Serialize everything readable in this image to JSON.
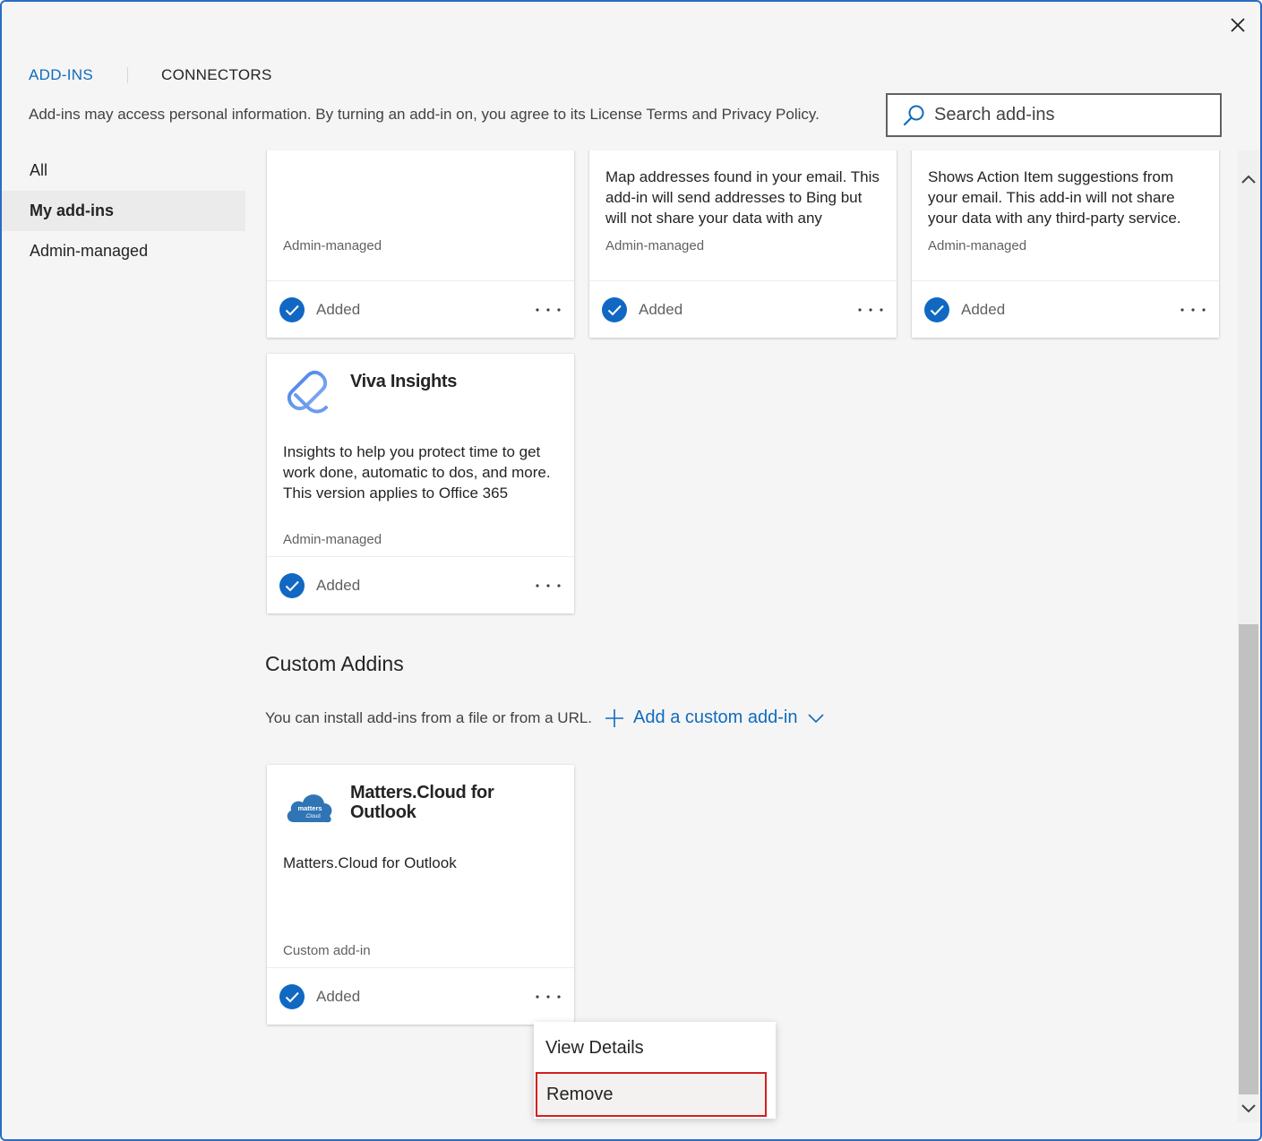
{
  "header": {
    "tabs": [
      {
        "label": "ADD-INS",
        "active": true
      },
      {
        "label": "CONNECTORS",
        "active": false
      }
    ],
    "notice": "Add-ins may access personal information. By turning an add-in on, you agree to its License Terms and Privacy Policy.",
    "search": {
      "placeholder": "Search add-ins",
      "value": ""
    },
    "close_icon": "close-icon"
  },
  "nav": {
    "items": [
      {
        "label": "All",
        "active": false
      },
      {
        "label": "My add-ins",
        "active": true
      },
      {
        "label": "Admin-managed",
        "active": false
      }
    ]
  },
  "cards": [
    {
      "title": "",
      "desc": "",
      "source": "Admin-managed",
      "status": "Added"
    },
    {
      "title": "",
      "desc": "Map addresses found in your email. This add-in will send addresses to Bing but will not share your data with any",
      "source": "Admin-managed",
      "status": "Added"
    },
    {
      "title": "",
      "desc": "Shows Action Item suggestions from your email. This add-in will not share your data with any third-party service.",
      "source": "Admin-managed",
      "status": "Added"
    },
    {
      "title": "Viva Insights",
      "desc": "Insights to help you protect time to get work done, automatic to dos, and more. This version applies to Office 365",
      "source": "Admin-managed",
      "status": "Added"
    }
  ],
  "custom": {
    "section_title": "Custom Addins",
    "install_text": "You can install add-ins from a file or from a URL.",
    "add_label": "Add a custom add-in",
    "card": {
      "title": "Matters.Cloud for Outlook",
      "logo_text_1": "matters",
      "logo_text_2": ".Cloud",
      "desc": "Matters.Cloud for Outlook",
      "source": "Custom add-in",
      "status": "Added"
    }
  },
  "context_menu": {
    "items": [
      {
        "label": "View Details",
        "highlighted": false
      },
      {
        "label": "Remove",
        "highlighted": true
      }
    ]
  },
  "colors": {
    "accent": "#0f6cbd",
    "check": "#1168c2",
    "highlight_border": "#d32020"
  }
}
